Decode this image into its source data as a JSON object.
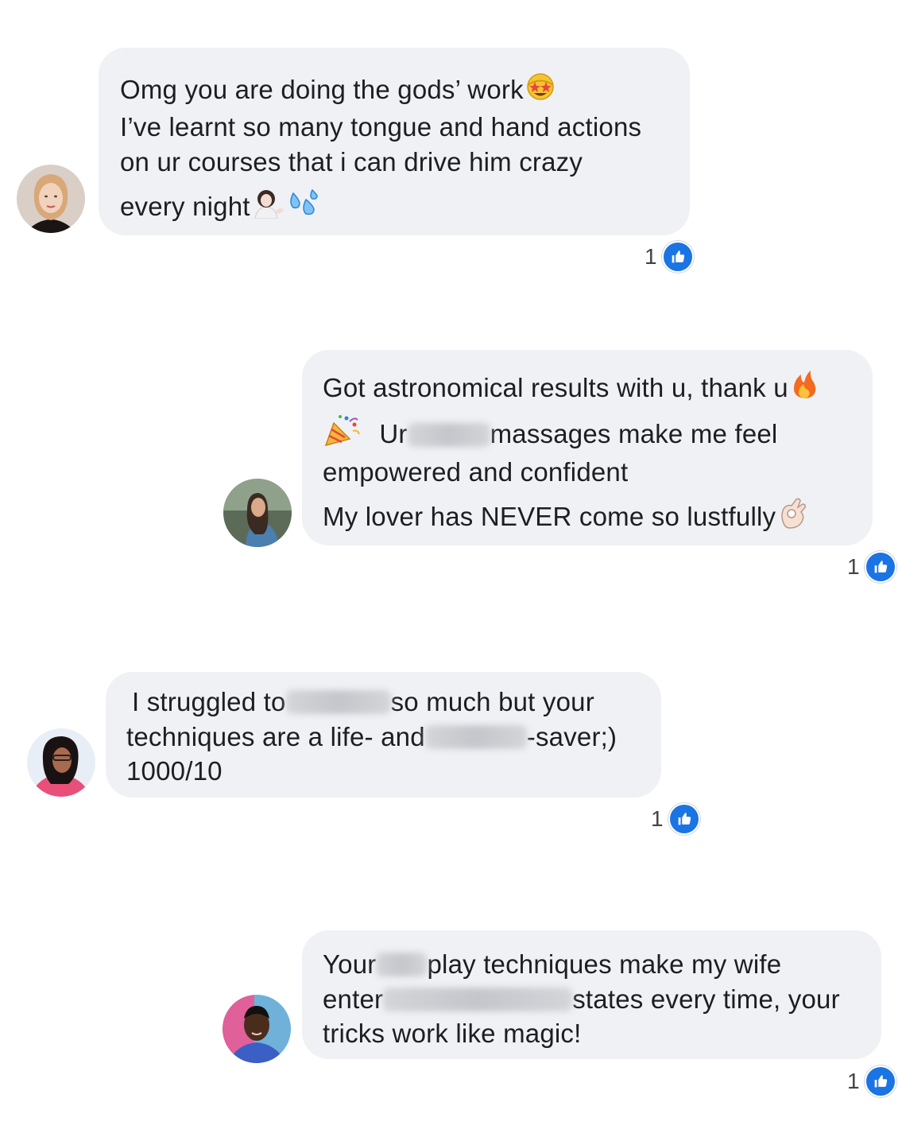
{
  "comments": [
    {
      "lines": [
        [
          "Omg you are doing the gods’ work"
        ],
        [
          "I’ve learnt so many tongue and hand actions"
        ],
        [
          "on ur courses that i can drive him crazy"
        ],
        [
          "every night"
        ]
      ],
      "emojis": [
        "star-struck-emoji",
        "woman-tipping-hand-emoji",
        "sweat-droplets-emoji"
      ],
      "reaction_count": "1",
      "reaction_icon": "like-icon"
    },
    {
      "lines": [
        [
          "Got astronomical results with u, thank u"
        ],
        [
          "Ur",
          "massages make me feel"
        ],
        [
          "empowered and confident"
        ],
        [
          "My lover has NEVER come so lustfully"
        ]
      ],
      "emojis": [
        "fire-emoji",
        "party-popper-emoji",
        "ok-hand-emoji"
      ],
      "reaction_count": "1",
      "reaction_icon": "like-icon"
    },
    {
      "lines": [
        [
          "I struggled to",
          "so much but your"
        ],
        [
          "techniques are a life- and",
          "-saver;)"
        ],
        [
          "1000/10"
        ]
      ],
      "emojis": [],
      "reaction_count": "1",
      "reaction_icon": "like-icon"
    },
    {
      "lines": [
        [
          "Your",
          "play techniques make my wife"
        ],
        [
          "enter",
          "states every time, your"
        ],
        [
          "tricks work like magic!"
        ]
      ],
      "emojis": [],
      "reaction_count": "1",
      "reaction_icon": "like-icon"
    }
  ],
  "colors": {
    "bubble": "#eff1f4",
    "like": "#1b74e4",
    "text": "#1c1e21"
  }
}
